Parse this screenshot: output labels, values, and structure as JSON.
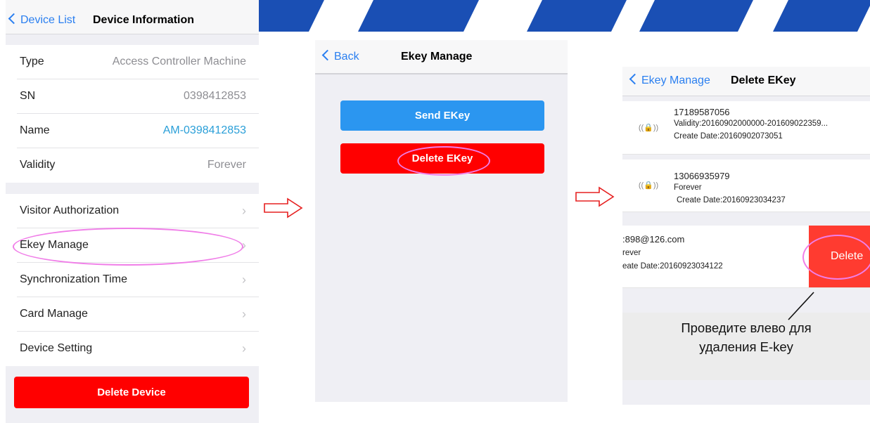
{
  "panel1": {
    "back_label": "Device List",
    "title": "Device Information",
    "info_rows": [
      {
        "label": "Type",
        "value": "Access Controller Machine"
      },
      {
        "label": "SN",
        "value": "0398412853"
      },
      {
        "label": "Name",
        "value": "AM-0398412853"
      },
      {
        "label": "Validity",
        "value": "Forever"
      }
    ],
    "menu_items": [
      {
        "label": "Visitor Authorization"
      },
      {
        "label": "Ekey Manage"
      },
      {
        "label": "Synchronization Time"
      },
      {
        "label": "Card Manage"
      },
      {
        "label": "Device Setting"
      }
    ],
    "delete_device_label": "Delete Device"
  },
  "panel2": {
    "back_label": "Back",
    "title": "Ekey Manage",
    "send_label": "Send EKey",
    "delete_label": "Delete EKey"
  },
  "panel3": {
    "back_label": "Ekey Manage",
    "title": "Delete EKey",
    "ekeys": [
      {
        "line1": "17189587056",
        "line2": "Validity:20160902000000-201609022359...",
        "line3": "Create Date:20160902073051"
      },
      {
        "line1": "13066935979",
        "line2": "Forever",
        "line3": "Create Date:20160923034237"
      },
      {
        "line1": ":898@126.com",
        "line2": "rever",
        "line3": "eate Date:20160923034122"
      }
    ],
    "delete_action_label": "Delete",
    "caption_line1": "Проведите влево для",
    "caption_line2": "удаления E-key"
  },
  "colors": {
    "accent_blue": "#2a7ff0",
    "send_blue": "#2b96f0",
    "delete_red": "#ff0000",
    "swipe_red": "#ff3b30",
    "highlight_pink": "#f07ee8",
    "arrow_red": "#e62020"
  },
  "icons": {
    "back": "chevron-left-icon",
    "disclosure": "chevron-right-icon",
    "ekey": "lock-signal-icon",
    "flow_arrow": "right-arrow-outline-icon"
  }
}
